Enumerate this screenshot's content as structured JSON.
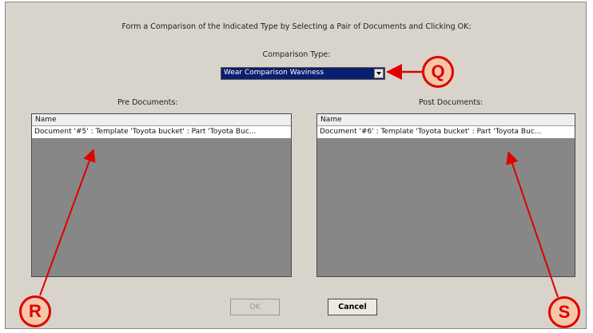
{
  "dialog": {
    "instruction": "Form a Comparison of the Indicated Type by Selecting a Pair of Documents and Clicking OK:",
    "comparison_type_label": "Comparison Type:",
    "comparison_type_value": "Wear Comparison Waviness",
    "pre_label": "Pre Documents:",
    "post_label": "Post Documents:",
    "pre_list": {
      "header": "Name",
      "rows": [
        "Document '#5' : Template 'Toyota bucket' : Part 'Toyota Buc..."
      ]
    },
    "post_list": {
      "header": "Name",
      "rows": [
        "Document '#6' : Template 'Toyota bucket' : Part 'Toyota Buc..."
      ]
    },
    "ok_label": "OK",
    "cancel_label": "Cancel"
  },
  "callouts": {
    "q": "Q",
    "r": "R",
    "s": "S"
  },
  "colors": {
    "callout_red": "#e00000",
    "callout_fill": "#f3c7a8",
    "selection_blue": "#0a1f6e",
    "list_bg": "#878787"
  }
}
